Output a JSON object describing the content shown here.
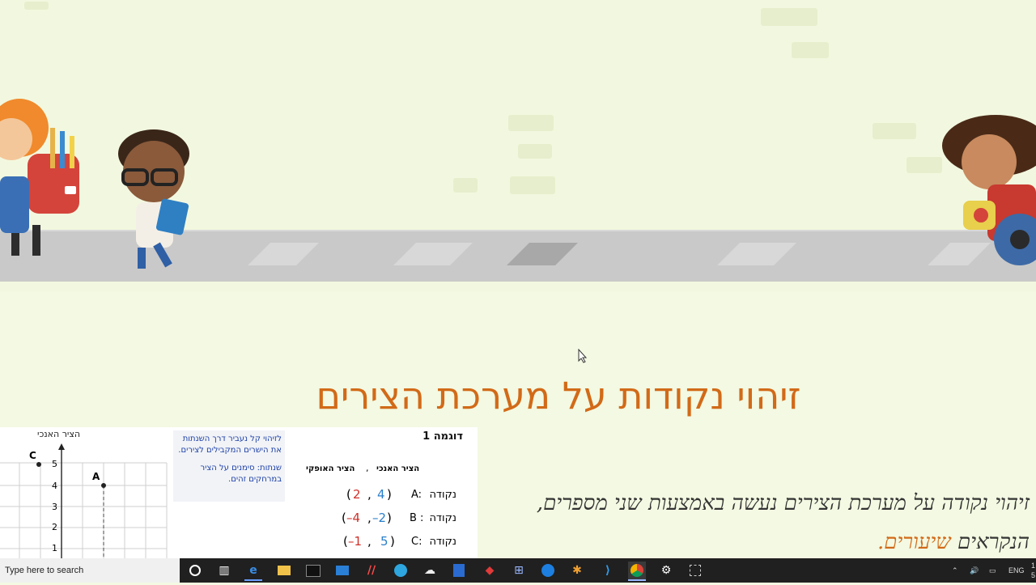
{
  "lesson": {
    "title": "זיהוי נקודות על מערכת הצירים",
    "narration_main": "זיהוי נקודה על מערכת הצירים נעשה באמצעות שני מספרים, הנקראים",
    "narration_highlight": "שיעורים."
  },
  "figure": {
    "example_label": "דוגמה 1",
    "vertical_axis_label": "הציר האנכי",
    "horizontal_axis_label": "הציר האופקי",
    "comma": ",",
    "points": [
      {
        "label": "נקודה",
        "name": "A:",
        "x": "2",
        "y": "4",
        "x_color": "#d0302a",
        "y_color": "#2a7fc9"
      },
      {
        "label": "נקודה",
        "name": "B :",
        "x": "–4",
        "y": "–2",
        "x_color": "#d0302a",
        "y_color": "#2a7fc9"
      },
      {
        "label": "נקודה",
        "name": "C:",
        "x": "–1",
        "y": "5",
        "x_color": "#d0302a",
        "y_color": "#2a7fc9"
      }
    ],
    "tip_text": "לזיהוי קל נעביר דרך השנתות את הישרים המקבילים לצירים.",
    "tip_note": "שנתות: סימנים על הציר במרחקים זהים.",
    "graph_axis_title": "הציר האנכי",
    "graph_y_ticks": [
      "5",
      "4",
      "3",
      "2",
      "1"
    ],
    "graph_point_labels": [
      "C",
      "A"
    ]
  },
  "taskbar": {
    "search_placeholder": "Type here to search",
    "language": "ENG",
    "clock_fragment": "1",
    "clock_fragment2": "5",
    "icons": [
      "cortana-icon",
      "task-view-icon",
      "edge-icon",
      "file-explorer-icon",
      "terminal-icon",
      "mail-icon",
      "monday-icon",
      "telegram-icon",
      "cloud-icon",
      "security-icon",
      "diamond-icon",
      "network-icon",
      "teamviewer-icon",
      "puzzle-icon",
      "vscode-icon",
      "chrome-icon",
      "settings-icon",
      "snip-icon"
    ]
  },
  "colors": {
    "accent_orange": "#d26a18",
    "taskbar": "#202020",
    "background": "#f3f9e2"
  }
}
